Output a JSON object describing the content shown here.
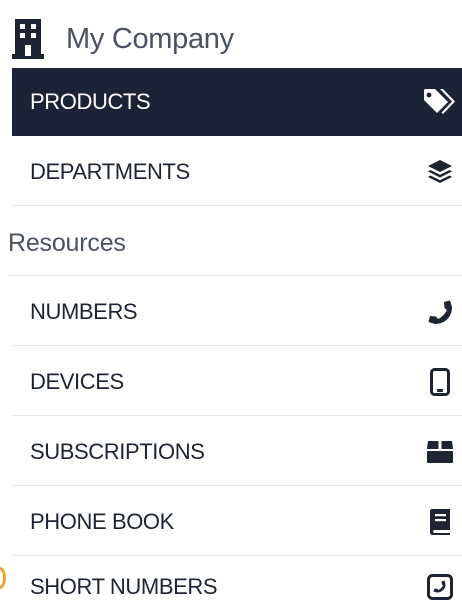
{
  "header": {
    "company_name": "My Company",
    "icon": "building-icon"
  },
  "menu": {
    "products": {
      "label": "PRODUCTS",
      "icon": "tags-icon",
      "active": true
    },
    "departments": {
      "label": "DEPARTMENTS",
      "icon": "layers-icon",
      "active": false
    }
  },
  "resources": {
    "title": "Resources",
    "items": [
      {
        "label": "NUMBERS",
        "icon": "phone-icon"
      },
      {
        "label": "DEVICES",
        "icon": "mobile-icon"
      },
      {
        "label": "SUBSCRIPTIONS",
        "icon": "box-icon"
      },
      {
        "label": "PHONE BOOK",
        "icon": "book-icon"
      },
      {
        "label": "SHORT NUMBERS",
        "icon": "phone-square-icon"
      }
    ]
  },
  "colors": {
    "active_bg": "#1b2436",
    "text": "#1e2433",
    "muted": "#4b5262",
    "divider": "#e4e6ea"
  }
}
